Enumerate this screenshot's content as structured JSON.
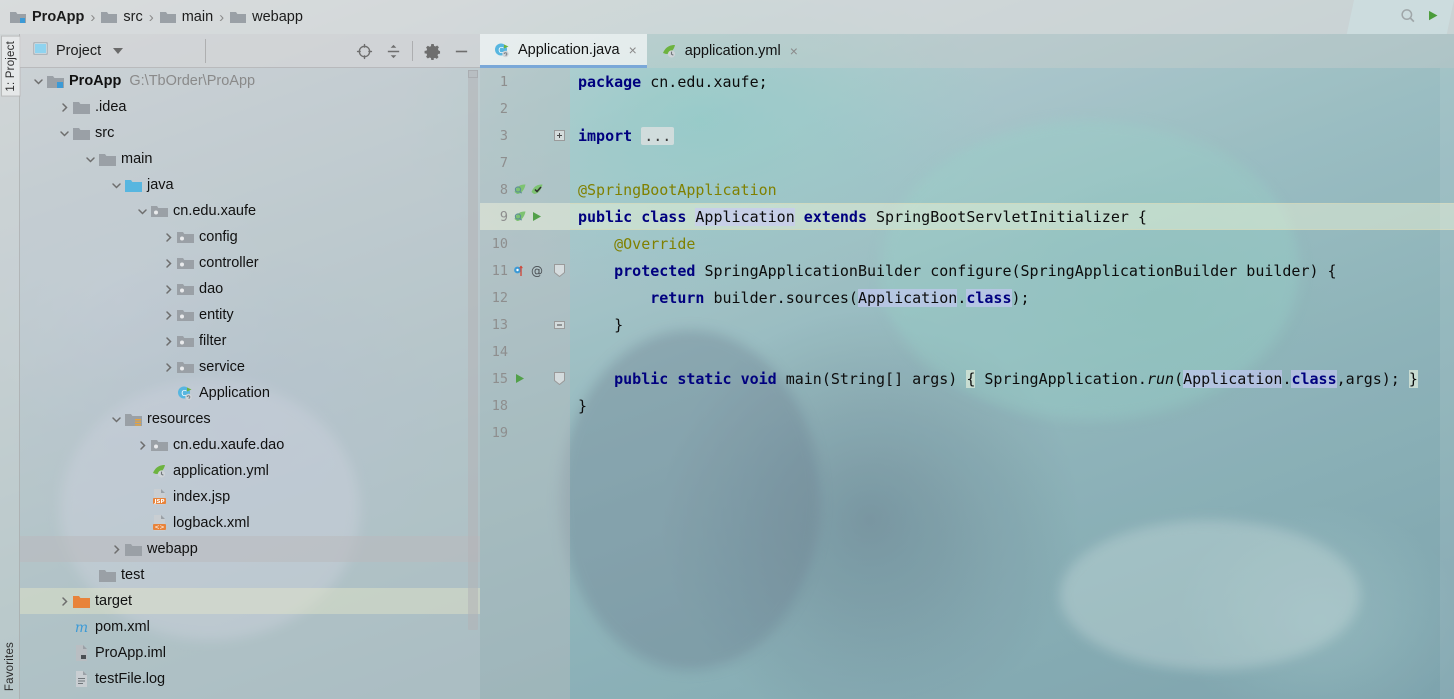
{
  "app": {
    "ide": "IntelliJ IDEA",
    "window_title": "ProApp"
  },
  "navbar": {
    "crumbs": [
      {
        "label": "ProApp",
        "icon": "module-folder-icon"
      },
      {
        "label": "src",
        "icon": "folder-icon"
      },
      {
        "label": "main",
        "icon": "folder-icon"
      },
      {
        "label": "webapp",
        "icon": "folder-icon"
      }
    ],
    "separator": "›",
    "right_icons": [
      "search-everywhere-icon",
      "run-icon"
    ]
  },
  "left_strip": {
    "project_button": "1: Project",
    "favorites_button": "Favorites"
  },
  "project_panel": {
    "title": "Project",
    "dropdown_caret": "▾",
    "tools": [
      {
        "name": "locate-icon",
        "title": "Select Opened File"
      },
      {
        "name": "collapse-all-icon",
        "title": "Collapse All"
      },
      {
        "name": "gear-icon",
        "title": "Settings"
      },
      {
        "name": "hide-icon",
        "title": "Hide"
      }
    ],
    "tree": [
      {
        "indent": 0,
        "arrow": "down",
        "icon": "module-folder-icon",
        "label": "ProApp",
        "bold": true,
        "sub": "G:\\TbOrder\\ProApp",
        "state": "normal"
      },
      {
        "indent": 1,
        "arrow": "right",
        "icon": "folder-icon",
        "label": ".idea",
        "state": "normal"
      },
      {
        "indent": 1,
        "arrow": "down",
        "icon": "folder-icon",
        "label": "src",
        "state": "normal"
      },
      {
        "indent": 2,
        "arrow": "down",
        "icon": "folder-icon",
        "label": "main",
        "state": "normal"
      },
      {
        "indent": 3,
        "arrow": "down",
        "icon": "source-folder-icon",
        "label": "java",
        "state": "normal"
      },
      {
        "indent": 4,
        "arrow": "down",
        "icon": "package-icon",
        "label": "cn.edu.xaufe",
        "state": "normal"
      },
      {
        "indent": 5,
        "arrow": "right",
        "icon": "package-icon",
        "label": "config",
        "state": "normal"
      },
      {
        "indent": 5,
        "arrow": "right",
        "icon": "package-icon",
        "label": "controller",
        "state": "normal"
      },
      {
        "indent": 5,
        "arrow": "right",
        "icon": "package-icon",
        "label": "dao",
        "state": "normal"
      },
      {
        "indent": 5,
        "arrow": "right",
        "icon": "package-icon",
        "label": "entity",
        "state": "normal"
      },
      {
        "indent": 5,
        "arrow": "right",
        "icon": "package-icon",
        "label": "filter",
        "state": "normal"
      },
      {
        "indent": 5,
        "arrow": "right",
        "icon": "package-icon",
        "label": "service",
        "state": "normal"
      },
      {
        "indent": 5,
        "arrow": "none",
        "icon": "java-class-spring-icon",
        "label": "Application",
        "state": "normal"
      },
      {
        "indent": 3,
        "arrow": "down",
        "icon": "resources-folder-icon",
        "label": "resources",
        "state": "normal"
      },
      {
        "indent": 4,
        "arrow": "right",
        "icon": "package-icon",
        "label": "cn.edu.xaufe.dao",
        "state": "normal"
      },
      {
        "indent": 4,
        "arrow": "none",
        "icon": "spring-yaml-icon",
        "label": "application.yml",
        "state": "normal"
      },
      {
        "indent": 4,
        "arrow": "none",
        "icon": "jsp-file-icon",
        "label": "index.jsp",
        "state": "normal"
      },
      {
        "indent": 4,
        "arrow": "none",
        "icon": "xml-file-icon",
        "label": "logback.xml",
        "state": "normal"
      },
      {
        "indent": 3,
        "arrow": "right",
        "icon": "folder-icon",
        "label": "webapp",
        "state": "selected"
      },
      {
        "indent": 2,
        "arrow": "none",
        "icon": "folder-icon",
        "label": "test",
        "state": "normal"
      },
      {
        "indent": 1,
        "arrow": "right",
        "icon": "excluded-folder-icon",
        "label": "target",
        "state": "highlighted"
      },
      {
        "indent": 1,
        "arrow": "none",
        "icon": "maven-icon",
        "label": "pom.xml",
        "state": "normal"
      },
      {
        "indent": 1,
        "arrow": "none",
        "icon": "iml-file-icon",
        "label": "ProApp.iml",
        "state": "normal"
      },
      {
        "indent": 1,
        "arrow": "none",
        "icon": "log-file-icon",
        "label": "testFile.log",
        "state": "normal"
      }
    ]
  },
  "editor": {
    "tabs": [
      {
        "label": "Application.java",
        "icon": "java-class-spring-icon",
        "active": true,
        "close": "×"
      },
      {
        "label": "application.yml",
        "icon": "spring-yaml-icon",
        "active": false,
        "close": "×"
      }
    ],
    "current_line": 9,
    "lines": [
      {
        "num": "1",
        "icons": [],
        "fold": "",
        "text_parts": [
          {
            "t": "package ",
            "c": "kw"
          },
          {
            "t": "cn.edu.xaufe;",
            "c": "ident"
          }
        ]
      },
      {
        "num": "2",
        "icons": [],
        "fold": "",
        "text_parts": []
      },
      {
        "num": "3",
        "icons": [],
        "fold": "plus",
        "text_parts": [
          {
            "t": "import ",
            "c": "kw"
          },
          {
            "t": "...",
            "c": "fold"
          }
        ]
      },
      {
        "num": "7",
        "icons": [],
        "fold": "",
        "text_parts": []
      },
      {
        "num": "8",
        "icons": [
          "spring-bean-icon",
          "spring-config-icon"
        ],
        "fold": "",
        "text_parts": [
          {
            "t": "@SpringBootApplication",
            "c": "anno"
          }
        ]
      },
      {
        "num": "9",
        "icons": [
          "spring-bean-icon",
          "run-icon"
        ],
        "fold": "",
        "text_parts": [
          {
            "t": "public ",
            "c": "kw"
          },
          {
            "t": "class ",
            "c": "kw"
          },
          {
            "t": "Application",
            "c": "hl"
          },
          {
            "t": " ",
            "c": "ident"
          },
          {
            "t": "extends ",
            "c": "kw"
          },
          {
            "t": "SpringBootServletInitializer {",
            "c": "ident"
          }
        ]
      },
      {
        "num": "10",
        "icons": [],
        "fold": "",
        "text_parts": [
          {
            "t": "    @Override",
            "c": "anno"
          }
        ]
      },
      {
        "num": "11",
        "icons": [
          "override-icon",
          "annotation-icon"
        ],
        "fold": "region-start",
        "text_parts": [
          {
            "t": "    protected ",
            "c": "kw"
          },
          {
            "t": "SpringApplicationBuilder configure(SpringApplicationBuilder builder) {",
            "c": "ident"
          }
        ]
      },
      {
        "num": "12",
        "icons": [],
        "fold": "",
        "text_parts": [
          {
            "t": "        ",
            "c": "ident"
          },
          {
            "t": "return ",
            "c": "kw"
          },
          {
            "t": "builder.sources(",
            "c": "ident"
          },
          {
            "t": "Application",
            "c": "hl"
          },
          {
            "t": ".",
            "c": "ident"
          },
          {
            "t": "class",
            "c": "kwhl"
          },
          {
            "t": ");",
            "c": "ident"
          }
        ]
      },
      {
        "num": "13",
        "icons": [],
        "fold": "region-end",
        "text_parts": [
          {
            "t": "    }",
            "c": "ident"
          }
        ]
      },
      {
        "num": "14",
        "icons": [],
        "fold": "",
        "text_parts": []
      },
      {
        "num": "15",
        "icons": [
          "run-icon"
        ],
        "fold": "region-start2",
        "text_parts": [
          {
            "t": "    public ",
            "c": "kw"
          },
          {
            "t": "static ",
            "c": "kw"
          },
          {
            "t": "void ",
            "c": "kw"
          },
          {
            "t": "main(String[] args) ",
            "c": "ident"
          },
          {
            "t": "{",
            "c": "brace"
          },
          {
            "t": " SpringApplication.",
            "c": "ident"
          },
          {
            "t": "run",
            "c": "ital"
          },
          {
            "t": "(",
            "c": "ident"
          },
          {
            "t": "Application",
            "c": "hl"
          },
          {
            "t": ".",
            "c": "ident"
          },
          {
            "t": "class",
            "c": "kwhl"
          },
          {
            "t": ",args); ",
            "c": "ident"
          },
          {
            "t": "}",
            "c": "brace"
          }
        ]
      },
      {
        "num": "18",
        "icons": [],
        "fold": "",
        "text_parts": [
          {
            "t": "}",
            "c": "ident"
          }
        ]
      },
      {
        "num": "19",
        "icons": [],
        "fold": "",
        "text_parts": []
      }
    ]
  },
  "colors": {
    "keyword": "#00007f",
    "annotation": "#808000",
    "selection_highlight": "#c8c8f5",
    "active_tab_underline": "#7aa8d8",
    "accent_blue": "#3c9ad6",
    "folder_gray": "#9aa0a6",
    "folder_orange": "#e8833a",
    "source_blue": "#57b6e0",
    "spring_green": "#6db33f"
  }
}
